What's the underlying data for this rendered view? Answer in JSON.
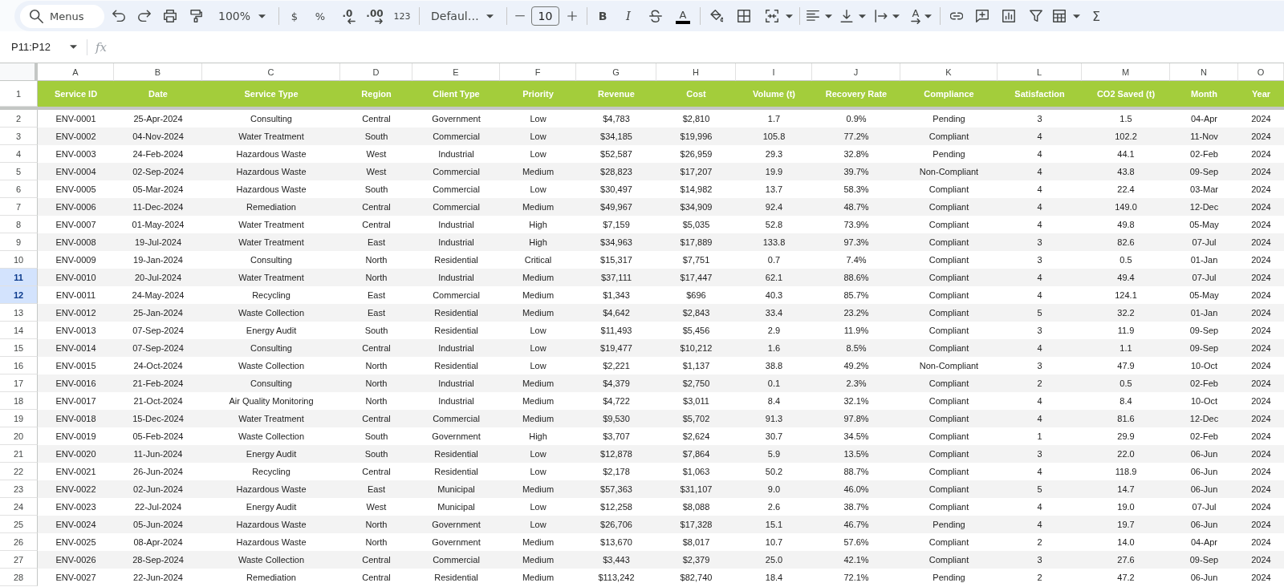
{
  "toolbar": {
    "search": {
      "placeholder": "Menus"
    },
    "zoom": "100%",
    "currency": "$",
    "percent": "%",
    "decrease_decimals": ".0",
    "increase_decimals": ".00",
    "number_format": "123",
    "font": "Defaul…",
    "font_size": "10",
    "bold": "B",
    "italic": "I",
    "text_color": "A",
    "text_rotation": "A",
    "functions": "Σ"
  },
  "formula_bar": {
    "name_box": "P11:P12",
    "function_label": "fx"
  },
  "sheet": {
    "column_letters": [
      "A",
      "B",
      "C",
      "D",
      "E",
      "F",
      "G",
      "H",
      "I",
      "J",
      "K",
      "L",
      "M",
      "N",
      "O"
    ],
    "header_row": {
      "number": "1",
      "cells": [
        "Service ID",
        "Date",
        "Service Type",
        "Region",
        "Client Type",
        "Priority",
        "Revenue",
        "Cost",
        "Volume (t)",
        "Recovery Rate",
        "Compliance",
        "Satisfaction",
        "CO2 Saved (t)",
        "Month",
        "Year"
      ]
    },
    "rows": [
      {
        "number": "2",
        "selected": false,
        "cells": [
          "ENV-0001",
          "25-Apr-2024",
          "Consulting",
          "Central",
          "Government",
          "Low",
          "$4,783",
          "$2,810",
          "1.7",
          "0.9%",
          "Pending",
          "3",
          "1.5",
          "04-Apr",
          "2024"
        ]
      },
      {
        "number": "3",
        "selected": false,
        "cells": [
          "ENV-0002",
          "04-Nov-2024",
          "Water Treatment",
          "South",
          "Commercial",
          "Low",
          "$34,185",
          "$19,996",
          "105.8",
          "77.2%",
          "Compliant",
          "4",
          "102.2",
          "11-Nov",
          "2024"
        ]
      },
      {
        "number": "4",
        "selected": false,
        "cells": [
          "ENV-0003",
          "24-Feb-2024",
          "Hazardous Waste",
          "West",
          "Industrial",
          "Low",
          "$52,587",
          "$26,959",
          "29.3",
          "32.8%",
          "Pending",
          "4",
          "44.1",
          "02-Feb",
          "2024"
        ]
      },
      {
        "number": "5",
        "selected": false,
        "cells": [
          "ENV-0004",
          "02-Sep-2024",
          "Hazardous Waste",
          "West",
          "Commercial",
          "Medium",
          "$28,823",
          "$17,207",
          "19.9",
          "39.7%",
          "Non-Compliant",
          "4",
          "43.8",
          "09-Sep",
          "2024"
        ]
      },
      {
        "number": "6",
        "selected": false,
        "cells": [
          "ENV-0005",
          "05-Mar-2024",
          "Hazardous Waste",
          "South",
          "Commercial",
          "Low",
          "$30,497",
          "$14,982",
          "13.7",
          "58.3%",
          "Compliant",
          "4",
          "22.4",
          "03-Mar",
          "2024"
        ]
      },
      {
        "number": "7",
        "selected": false,
        "cells": [
          "ENV-0006",
          "11-Dec-2024",
          "Remediation",
          "Central",
          "Commercial",
          "Medium",
          "$49,967",
          "$34,909",
          "92.4",
          "48.7%",
          "Compliant",
          "4",
          "149.0",
          "12-Dec",
          "2024"
        ]
      },
      {
        "number": "8",
        "selected": false,
        "cells": [
          "ENV-0007",
          "01-May-2024",
          "Water Treatment",
          "Central",
          "Industrial",
          "High",
          "$7,159",
          "$5,035",
          "52.8",
          "73.9%",
          "Compliant",
          "4",
          "49.8",
          "05-May",
          "2024"
        ]
      },
      {
        "number": "9",
        "selected": false,
        "cells": [
          "ENV-0008",
          "19-Jul-2024",
          "Water Treatment",
          "East",
          "Industrial",
          "High",
          "$34,963",
          "$17,889",
          "133.8",
          "97.3%",
          "Compliant",
          "3",
          "82.6",
          "07-Jul",
          "2024"
        ]
      },
      {
        "number": "10",
        "selected": false,
        "cells": [
          "ENV-0009",
          "19-Jan-2024",
          "Consulting",
          "North",
          "Residential",
          "Critical",
          "$15,317",
          "$7,751",
          "0.7",
          "7.4%",
          "Compliant",
          "3",
          "0.5",
          "01-Jan",
          "2024"
        ]
      },
      {
        "number": "11",
        "selected": true,
        "cells": [
          "ENV-0010",
          "20-Jul-2024",
          "Water Treatment",
          "North",
          "Industrial",
          "Medium",
          "$37,111",
          "$17,447",
          "62.1",
          "88.6%",
          "Compliant",
          "4",
          "49.4",
          "07-Jul",
          "2024"
        ]
      },
      {
        "number": "12",
        "selected": true,
        "cells": [
          "ENV-0011",
          "24-May-2024",
          "Recycling",
          "East",
          "Commercial",
          "Medium",
          "$1,343",
          "$696",
          "40.3",
          "85.7%",
          "Compliant",
          "4",
          "124.1",
          "05-May",
          "2024"
        ]
      },
      {
        "number": "13",
        "selected": false,
        "cells": [
          "ENV-0012",
          "25-Jan-2024",
          "Waste Collection",
          "East",
          "Residential",
          "Medium",
          "$4,642",
          "$2,843",
          "33.4",
          "23.2%",
          "Compliant",
          "5",
          "32.2",
          "01-Jan",
          "2024"
        ]
      },
      {
        "number": "14",
        "selected": false,
        "cells": [
          "ENV-0013",
          "07-Sep-2024",
          "Energy Audit",
          "South",
          "Residential",
          "Low",
          "$11,493",
          "$5,456",
          "2.9",
          "11.9%",
          "Compliant",
          "3",
          "11.9",
          "09-Sep",
          "2024"
        ]
      },
      {
        "number": "15",
        "selected": false,
        "cells": [
          "ENV-0014",
          "07-Sep-2024",
          "Consulting",
          "Central",
          "Industrial",
          "Low",
          "$19,477",
          "$10,212",
          "1.6",
          "8.5%",
          "Compliant",
          "4",
          "1.1",
          "09-Sep",
          "2024"
        ]
      },
      {
        "number": "16",
        "selected": false,
        "cells": [
          "ENV-0015",
          "24-Oct-2024",
          "Waste Collection",
          "North",
          "Residential",
          "Low",
          "$2,221",
          "$1,137",
          "38.8",
          "49.2%",
          "Non-Compliant",
          "3",
          "47.9",
          "10-Oct",
          "2024"
        ]
      },
      {
        "number": "17",
        "selected": false,
        "cells": [
          "ENV-0016",
          "21-Feb-2024",
          "Consulting",
          "North",
          "Industrial",
          "Medium",
          "$4,379",
          "$2,750",
          "0.1",
          "2.3%",
          "Compliant",
          "2",
          "0.5",
          "02-Feb",
          "2024"
        ]
      },
      {
        "number": "18",
        "selected": false,
        "cells": [
          "ENV-0017",
          "21-Oct-2024",
          "Air Quality Monitoring",
          "North",
          "Industrial",
          "Medium",
          "$4,722",
          "$3,011",
          "8.4",
          "32.1%",
          "Compliant",
          "4",
          "8.4",
          "10-Oct",
          "2024"
        ]
      },
      {
        "number": "19",
        "selected": false,
        "cells": [
          "ENV-0018",
          "15-Dec-2024",
          "Water Treatment",
          "Central",
          "Commercial",
          "Medium",
          "$9,530",
          "$5,702",
          "91.3",
          "97.8%",
          "Compliant",
          "4",
          "81.6",
          "12-Dec",
          "2024"
        ]
      },
      {
        "number": "20",
        "selected": false,
        "cells": [
          "ENV-0019",
          "05-Feb-2024",
          "Waste Collection",
          "South",
          "Government",
          "High",
          "$3,707",
          "$2,624",
          "30.7",
          "34.5%",
          "Compliant",
          "1",
          "29.9",
          "02-Feb",
          "2024"
        ]
      },
      {
        "number": "21",
        "selected": false,
        "cells": [
          "ENV-0020",
          "11-Jun-2024",
          "Energy Audit",
          "South",
          "Residential",
          "Low",
          "$12,878",
          "$7,864",
          "5.9",
          "13.5%",
          "Compliant",
          "3",
          "22.0",
          "06-Jun",
          "2024"
        ]
      },
      {
        "number": "22",
        "selected": false,
        "cells": [
          "ENV-0021",
          "26-Jun-2024",
          "Recycling",
          "Central",
          "Residential",
          "Low",
          "$2,178",
          "$1,063",
          "50.2",
          "88.7%",
          "Compliant",
          "4",
          "118.9",
          "06-Jun",
          "2024"
        ]
      },
      {
        "number": "23",
        "selected": false,
        "cells": [
          "ENV-0022",
          "02-Jun-2024",
          "Hazardous Waste",
          "East",
          "Municipal",
          "Medium",
          "$57,363",
          "$31,107",
          "9.0",
          "46.0%",
          "Compliant",
          "5",
          "14.7",
          "06-Jun",
          "2024"
        ]
      },
      {
        "number": "24",
        "selected": false,
        "cells": [
          "ENV-0023",
          "22-Jul-2024",
          "Energy Audit",
          "West",
          "Municipal",
          "Low",
          "$12,258",
          "$8,088",
          "2.6",
          "38.7%",
          "Compliant",
          "4",
          "19.0",
          "07-Jul",
          "2024"
        ]
      },
      {
        "number": "25",
        "selected": false,
        "cells": [
          "ENV-0024",
          "05-Jun-2024",
          "Hazardous Waste",
          "North",
          "Government",
          "Low",
          "$26,706",
          "$17,328",
          "15.1",
          "46.7%",
          "Pending",
          "4",
          "19.7",
          "06-Jun",
          "2024"
        ]
      },
      {
        "number": "26",
        "selected": false,
        "cells": [
          "ENV-0025",
          "08-Apr-2024",
          "Hazardous Waste",
          "North",
          "Government",
          "Medium",
          "$13,670",
          "$8,017",
          "10.7",
          "57.6%",
          "Compliant",
          "2",
          "14.0",
          "04-Apr",
          "2024"
        ]
      },
      {
        "number": "27",
        "selected": false,
        "cells": [
          "ENV-0026",
          "28-Sep-2024",
          "Waste Collection",
          "Central",
          "Commercial",
          "Medium",
          "$3,443",
          "$2,379",
          "25.0",
          "42.1%",
          "Compliant",
          "3",
          "27.6",
          "09-Sep",
          "2024"
        ]
      },
      {
        "number": "28",
        "selected": false,
        "cells": [
          "ENV-0027",
          "22-Jun-2024",
          "Remediation",
          "Central",
          "Residential",
          "Medium",
          "$113,242",
          "$82,740",
          "18.4",
          "72.1%",
          "Pending",
          "2",
          "47.2",
          "06-Jun",
          "2024"
        ]
      }
    ]
  }
}
